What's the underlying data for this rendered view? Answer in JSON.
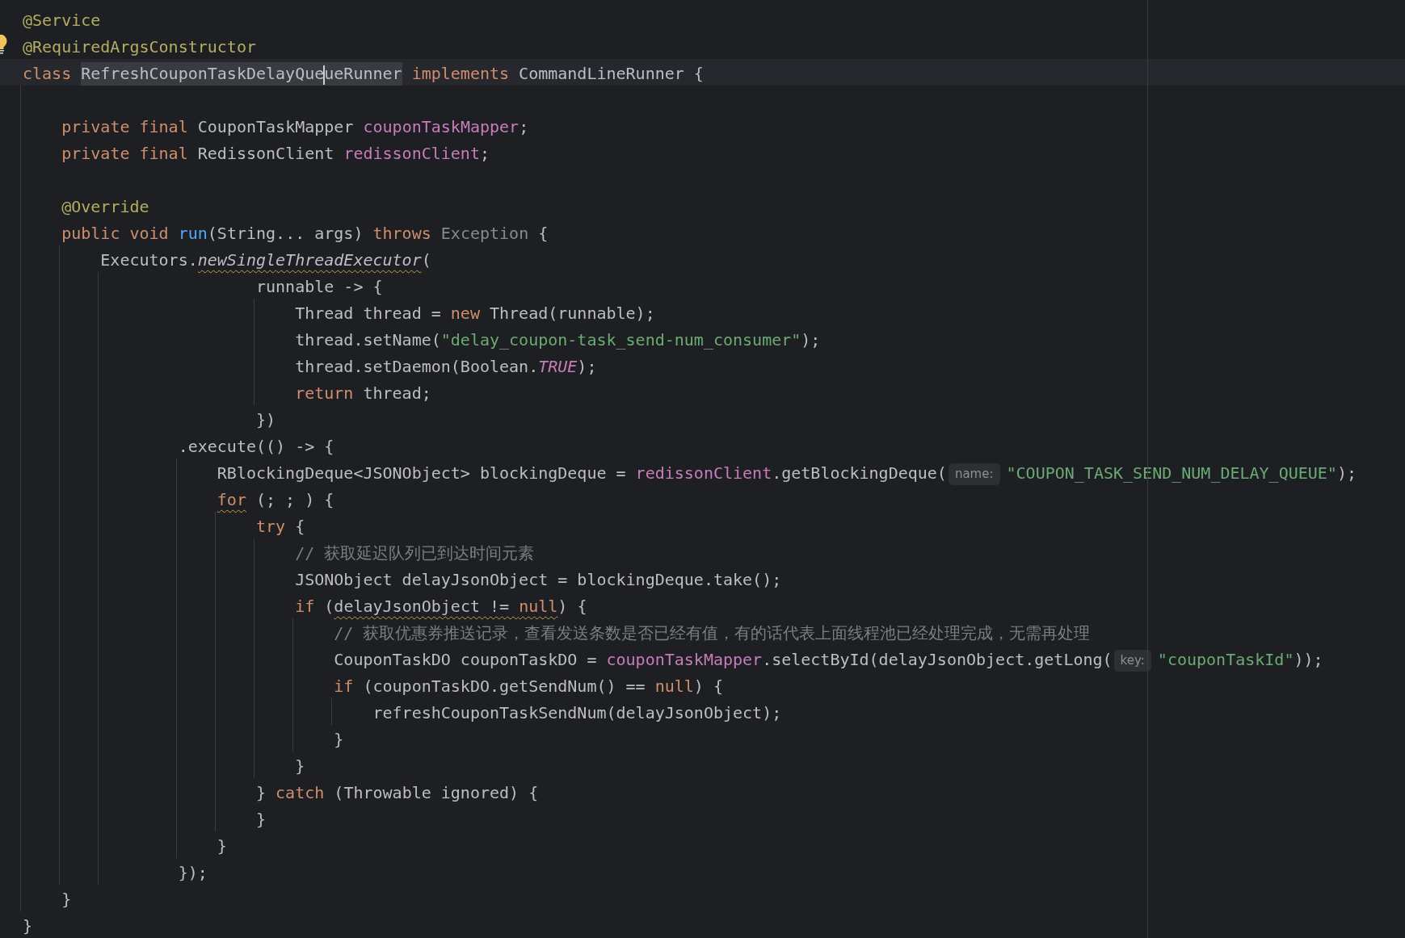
{
  "editor": {
    "lines": [
      {
        "kind": "code",
        "tokens": [
          {
            "kind": "annotation",
            "text": "@Service"
          }
        ]
      },
      {
        "kind": "code",
        "intention_bulb": true,
        "tokens": [
          {
            "kind": "annotation",
            "text": "@RequiredArgsConstructor"
          }
        ]
      },
      {
        "kind": "code",
        "tokens": [
          {
            "kind": "keyword",
            "text": "class "
          },
          {
            "kind": "highlight",
            "tokens": [
              {
                "kind": "plain",
                "text": "RefreshCouponTaskDelayQue"
              },
              {
                "kind": "caret"
              },
              {
                "kind": "plain",
                "text": "ueRunner"
              }
            ]
          },
          {
            "kind": "keyword",
            "text": " implements"
          },
          {
            "kind": "plain",
            "text": " CommandLineRunner {"
          }
        ]
      },
      {
        "kind": "blank"
      },
      {
        "kind": "code",
        "tokens": [
          {
            "kind": "keyword",
            "text": "    private final"
          },
          {
            "kind": "plain",
            "text": " CouponTaskMapper "
          },
          {
            "kind": "field",
            "text": "couponTaskMapper"
          },
          {
            "kind": "plain",
            "text": ";"
          }
        ]
      },
      {
        "kind": "code",
        "tokens": [
          {
            "kind": "keyword",
            "text": "    private final"
          },
          {
            "kind": "plain",
            "text": " RedissonClient "
          },
          {
            "kind": "field",
            "text": "redissonClient"
          },
          {
            "kind": "plain",
            "text": ";"
          }
        ]
      },
      {
        "kind": "blank"
      },
      {
        "kind": "code",
        "tokens": [
          {
            "kind": "annotation",
            "text": "    @Override"
          }
        ]
      },
      {
        "kind": "code",
        "tokens": [
          {
            "kind": "keyword",
            "text": "    public void "
          },
          {
            "kind": "method-decl",
            "text": "run"
          },
          {
            "kind": "plain",
            "text": "(String... args) "
          },
          {
            "kind": "keyword",
            "text": "throws "
          },
          {
            "kind": "dim",
            "text": "Exception"
          },
          {
            "kind": "plain",
            "text": " {"
          }
        ]
      },
      {
        "kind": "code",
        "tokens": [
          {
            "kind": "plain",
            "text": "        Executors."
          },
          {
            "kind": "warning",
            "tokens": [
              {
                "kind": "static-call",
                "text": "newSingleThreadExecutor"
              }
            ]
          },
          {
            "kind": "plain",
            "text": "("
          }
        ]
      },
      {
        "kind": "code",
        "tokens": [
          {
            "kind": "plain",
            "text": "                        runnable -> {"
          }
        ]
      },
      {
        "kind": "code",
        "tokens": [
          {
            "kind": "plain",
            "text": "                            Thread thread = "
          },
          {
            "kind": "keyword",
            "text": "new"
          },
          {
            "kind": "plain",
            "text": " Thread(runnable);"
          }
        ]
      },
      {
        "kind": "code",
        "tokens": [
          {
            "kind": "plain",
            "text": "                            thread.setName("
          },
          {
            "kind": "string",
            "text": "\"delay_coupon-task_send-num_consumer\""
          },
          {
            "kind": "plain",
            "text": ");"
          }
        ]
      },
      {
        "kind": "code",
        "tokens": [
          {
            "kind": "plain",
            "text": "                            thread.setDaemon(Boolean."
          },
          {
            "kind": "constant",
            "text": "TRUE"
          },
          {
            "kind": "plain",
            "text": ");"
          }
        ]
      },
      {
        "kind": "code",
        "tokens": [
          {
            "kind": "keyword",
            "text": "                            return"
          },
          {
            "kind": "plain",
            "text": " thread;"
          }
        ]
      },
      {
        "kind": "code",
        "tokens": [
          {
            "kind": "plain",
            "text": "                        })"
          }
        ]
      },
      {
        "kind": "code",
        "tokens": [
          {
            "kind": "plain",
            "text": "                .execute(() -> {"
          }
        ]
      },
      {
        "kind": "code",
        "tokens": [
          {
            "kind": "plain",
            "text": "                    RBlockingDeque<JSONObject> blockingDeque = "
          },
          {
            "kind": "field",
            "text": "redissonClient"
          },
          {
            "kind": "plain",
            "text": ".getBlockingDeque("
          },
          {
            "kind": "hint",
            "text": "name:"
          },
          {
            "kind": "string",
            "text": "\"COUPON_TASK_SEND_NUM_DELAY_QUEUE\""
          },
          {
            "kind": "plain",
            "text": ");"
          }
        ]
      },
      {
        "kind": "code",
        "tokens": [
          {
            "kind": "warning",
            "tokens": [
              {
                "kind": "keyword",
                "text": "                    for"
              }
            ]
          },
          {
            "kind": "plain",
            "text": " (; ; ) {"
          }
        ]
      },
      {
        "kind": "code",
        "tokens": [
          {
            "kind": "keyword",
            "text": "                        try"
          },
          {
            "kind": "plain",
            "text": " {"
          }
        ]
      },
      {
        "kind": "code",
        "tokens": [
          {
            "kind": "comment",
            "text": "                            // 获取延迟队列已到达时间元素"
          }
        ]
      },
      {
        "kind": "code",
        "tokens": [
          {
            "kind": "plain",
            "text": "                            JSONObject delayJsonObject = blockingDeque.take();"
          }
        ]
      },
      {
        "kind": "code",
        "tokens": [
          {
            "kind": "keyword",
            "text": "                            if"
          },
          {
            "kind": "plain",
            "text": " ("
          },
          {
            "kind": "warning",
            "tokens": [
              {
                "kind": "plain",
                "text": "delayJsonObject != "
              },
              {
                "kind": "keyword",
                "text": "null"
              }
            ]
          },
          {
            "kind": "plain",
            "text": ") {"
          }
        ]
      },
      {
        "kind": "code",
        "tokens": [
          {
            "kind": "comment",
            "text": "                                // 获取优惠券推送记录，查看发送条数是否已经有值，有的话代表上面线程池已经处理完成，无需再处理"
          }
        ]
      },
      {
        "kind": "code",
        "tokens": [
          {
            "kind": "plain",
            "text": "                                CouponTaskDO couponTaskDO = "
          },
          {
            "kind": "field",
            "text": "couponTaskMapper"
          },
          {
            "kind": "plain",
            "text": ".selectById(delayJsonObject.getLong("
          },
          {
            "kind": "hint",
            "text": "key:"
          },
          {
            "kind": "string",
            "text": "\"couponTaskId\""
          },
          {
            "kind": "plain",
            "text": "));"
          }
        ]
      },
      {
        "kind": "code",
        "tokens": [
          {
            "kind": "keyword",
            "text": "                                if"
          },
          {
            "kind": "plain",
            "text": " (couponTaskDO.getSendNum() == "
          },
          {
            "kind": "keyword",
            "text": "null"
          },
          {
            "kind": "plain",
            "text": ") {"
          }
        ]
      },
      {
        "kind": "code",
        "tokens": [
          {
            "kind": "plain",
            "text": "                                    refreshCouponTaskSendNum(delayJsonObject);"
          }
        ]
      },
      {
        "kind": "code",
        "tokens": [
          {
            "kind": "plain",
            "text": "                                }"
          }
        ]
      },
      {
        "kind": "code",
        "tokens": [
          {
            "kind": "plain",
            "text": "                            }"
          }
        ]
      },
      {
        "kind": "code",
        "tokens": [
          {
            "kind": "plain",
            "text": "                        } "
          },
          {
            "kind": "keyword",
            "text": "catch"
          },
          {
            "kind": "plain",
            "text": " (Throwable ignored) {"
          }
        ]
      },
      {
        "kind": "code",
        "tokens": [
          {
            "kind": "plain",
            "text": "                        }"
          }
        ]
      },
      {
        "kind": "code",
        "tokens": [
          {
            "kind": "plain",
            "text": "                    }"
          }
        ]
      },
      {
        "kind": "code",
        "tokens": [
          {
            "kind": "plain",
            "text": "                });"
          }
        ]
      },
      {
        "kind": "code",
        "tokens": [
          {
            "kind": "plain",
            "text": "    }"
          }
        ]
      },
      {
        "kind": "code",
        "tokens": [
          {
            "kind": "plain",
            "text": "}"
          }
        ]
      }
    ]
  }
}
